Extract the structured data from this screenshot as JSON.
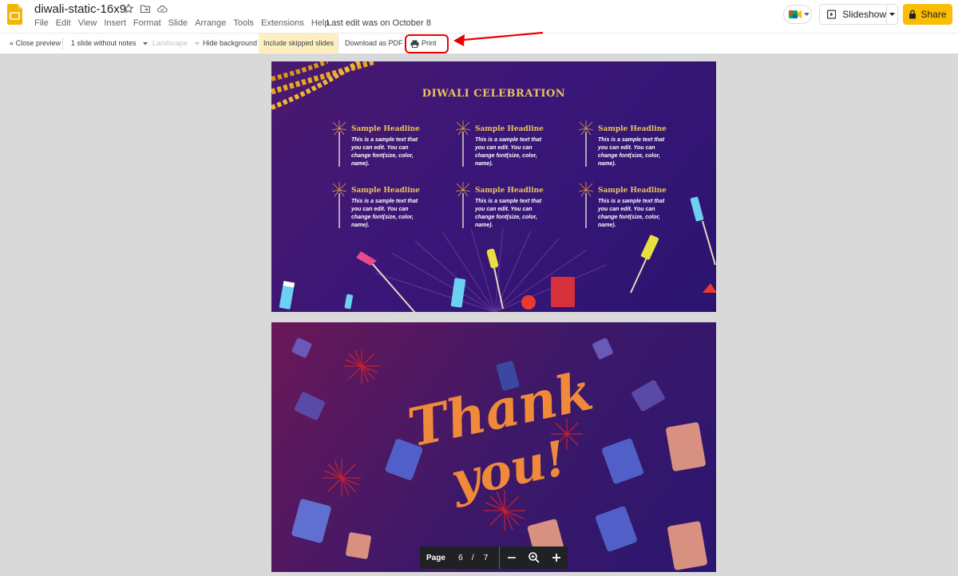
{
  "header": {
    "doc_title": "diwali-static-16x9",
    "menu": [
      "File",
      "Edit",
      "View",
      "Insert",
      "Format",
      "Slide",
      "Arrange",
      "Tools",
      "Extensions",
      "Help"
    ],
    "last_edit": "Last edit was on October 8",
    "slideshow_label": "Slideshow",
    "share_label": "Share",
    "brand_color": "#fbbc04"
  },
  "toolbar": {
    "close_preview": "« Close preview",
    "layout_option": "1 slide without notes",
    "orientation": "Landscape",
    "hide_background": "Hide background",
    "include_skipped": "Include skipped slides",
    "download_pdf": "Download as PDF",
    "print": "Print"
  },
  "slide1": {
    "title": "DIWALI CELEBRATION",
    "items": [
      {
        "headline": "Sample Headline",
        "body": "This is a sample text that you can edit. You can change font(size, color, name)."
      },
      {
        "headline": "Sample Headline",
        "body": "This is a sample text that you can edit. You can change font(size, color, name)."
      },
      {
        "headline": "Sample Headline",
        "body": "This is a sample text that you can edit. You can change font(size, color, name)."
      },
      {
        "headline": "Sample Headline",
        "body": "This is a sample text that you can edit. You can change font(size, color, name)."
      },
      {
        "headline": "Sample Headline",
        "body": "This is a sample text that you can edit. You can change font(size, color, name)."
      },
      {
        "headline": "Sample Headline",
        "body": "This is a sample text that you can edit. You can change font(size, color, name)."
      }
    ]
  },
  "slide2": {
    "line1": "Thank",
    "line2": "you!"
  },
  "pagenav": {
    "label": "Page",
    "current": "6",
    "separator": "/",
    "total": "7"
  },
  "annotation_color": "#e00000"
}
